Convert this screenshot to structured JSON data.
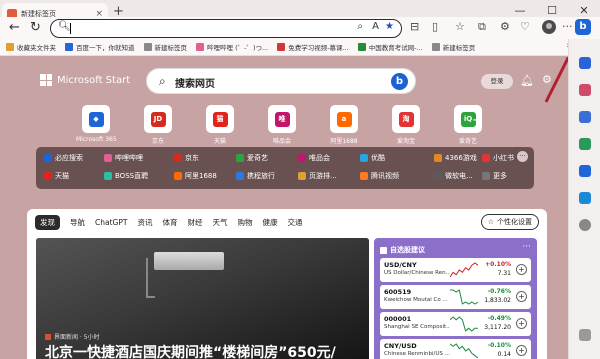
{
  "browser": {
    "tab_title": "新建标签页",
    "tab_close": "×",
    "new_tab": "+",
    "win_min": "—",
    "win_max": "☐",
    "win_close": "✕"
  },
  "omnibox": {
    "value": ""
  },
  "bookmarks": [
    {
      "label": "收藏夹文件夹",
      "color": "#e0a030"
    },
    {
      "label": "百度一下，你就知道",
      "color": "#2a62d8"
    },
    {
      "label": "新建标签页",
      "color": "#888888"
    },
    {
      "label": "哔哩哔哩 (゜-゜)つ...",
      "color": "#e0608f"
    },
    {
      "label": "免费学习视频-慕课...",
      "color": "#d03838"
    },
    {
      "label": "中国教育考试网-...",
      "color": "#2a8a3a"
    },
    {
      "label": "新建标签页",
      "color": "#888888"
    }
  ],
  "page": {
    "brand": "Microsoft Start",
    "search_placeholder": "搜索网页",
    "login_label": "登录"
  },
  "tiles": [
    {
      "label": "Microsoft 365",
      "color": "#1e66d8",
      "glyph": "◆"
    },
    {
      "label": "京东",
      "color": "#d52b1e",
      "glyph": "JD"
    },
    {
      "label": "天猫",
      "color": "#e2231a",
      "glyph": "猫"
    },
    {
      "label": "唯品会",
      "color": "#c1166b",
      "glyph": "唯"
    },
    {
      "label": "阿里1688",
      "color": "#ff6a00",
      "glyph": "a"
    },
    {
      "label": "爱淘宝",
      "color": "#e23434",
      "glyph": "淘"
    },
    {
      "label": "爱奇艺",
      "color": "#2ca43c",
      "glyph": "iQ"
    }
  ],
  "quick_links": [
    {
      "label": "必应搜索",
      "color": "#1e66d8"
    },
    {
      "label": "哔哩哔哩",
      "color": "#e0608f"
    },
    {
      "label": "京东",
      "color": "#d52b1e"
    },
    {
      "label": "爱奇艺",
      "color": "#2ca43c"
    },
    {
      "label": "唯品会",
      "color": "#c1166b"
    },
    {
      "label": "优酷",
      "color": "#2aa3e0"
    },
    {
      "label": "4366游戏",
      "color": "#e08a20"
    },
    {
      "label": "小红书",
      "color": "#e23434"
    },
    {
      "label": "天猫",
      "color": "#e2231a"
    },
    {
      "label": "BOSS直聘",
      "color": "#2bbfa4"
    },
    {
      "label": "阿里1688",
      "color": "#ff6a00"
    },
    {
      "label": "携程旅行",
      "color": "#2a7ae0"
    },
    {
      "label": "页游排...",
      "color": "#e0a030"
    },
    {
      "label": "腾讯视频",
      "color": "#ff7a20"
    },
    {
      "label": "微软电...",
      "color": "#5a5a5a"
    },
    {
      "label": "更多",
      "color": "#777777"
    }
  ],
  "quick_more": "···",
  "feed": {
    "tabs": [
      "发现",
      "导航",
      "ChatGPT",
      "资讯",
      "体育",
      "财经",
      "天气",
      "购物",
      "健康",
      "交通"
    ],
    "personalize": "个性化设置",
    "hero_source": "界面新闻 · 5小时",
    "hero_headline": "北京一快捷酒店国庆期间推“楼梯间房”650元/"
  },
  "stocks": {
    "title": "自选股建议",
    "menu": "···",
    "rows": [
      {
        "symbol": "USD/CNY",
        "name": "US Dollar/Chinese Ren...",
        "change": "+0.10%",
        "value": "7.31",
        "dir": "up",
        "spark": [
          3,
          5,
          4,
          6,
          5,
          7,
          6,
          8,
          9,
          8
        ]
      },
      {
        "symbol": "600519",
        "name": "Kweichow Moutai Co ...",
        "change": "-0.76%",
        "value": "1,833.02",
        "dir": "down",
        "spark": [
          9,
          9,
          8,
          9,
          2,
          3,
          2,
          3,
          2,
          3
        ]
      },
      {
        "symbol": "000001",
        "name": "Shanghai SE Composit...",
        "change": "-0.49%",
        "value": "3,117.20",
        "dir": "down",
        "spark": [
          6,
          7,
          6,
          7,
          6,
          2,
          3,
          2,
          3,
          3
        ]
      },
      {
        "symbol": "CNY/USD",
        "name": "Chinese Renminbi/US ...",
        "change": "-0.10%",
        "value": "0.14",
        "dir": "down",
        "spark": [
          8,
          7,
          8,
          6,
          7,
          5,
          6,
          4,
          3,
          2
        ]
      }
    ]
  }
}
